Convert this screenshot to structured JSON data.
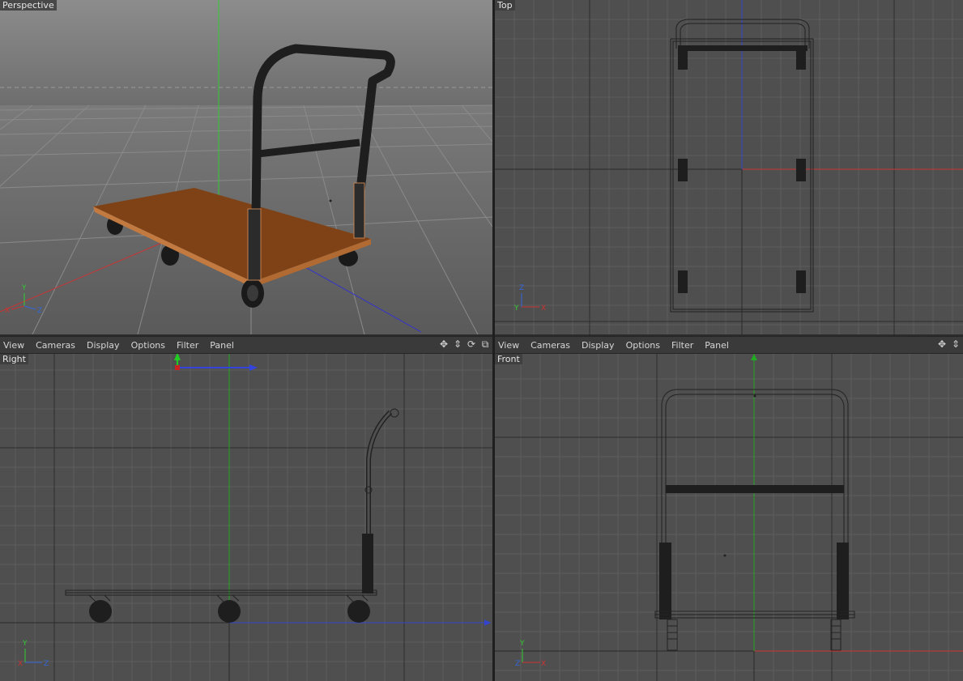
{
  "viewports": {
    "perspective": {
      "label": "Perspective"
    },
    "top": {
      "label": "Top"
    },
    "right": {
      "label": "Right"
    },
    "front": {
      "label": "Front"
    }
  },
  "menubar_left": {
    "items": [
      "View",
      "Cameras",
      "Display",
      "Options",
      "Filter",
      "Panel"
    ]
  },
  "menubar_right": {
    "items": [
      "View",
      "Cameras",
      "Display",
      "Options",
      "Filter",
      "Panel"
    ]
  },
  "axes": {
    "x": "X",
    "y": "Y",
    "z": "Z"
  },
  "icons": {
    "move": "move-icon",
    "scale": "scale-icon",
    "rotate": "rotate-icon",
    "maximize": "maximize-icon"
  },
  "colors": {
    "viewport_bg": "#4f4f4f",
    "grid": "#5f5f5f",
    "wood": "#8a4a1a",
    "wood_edge": "#d08850",
    "axis_x": "#cc2222",
    "axis_y": "#22bb22",
    "axis_z": "#2233cc"
  }
}
